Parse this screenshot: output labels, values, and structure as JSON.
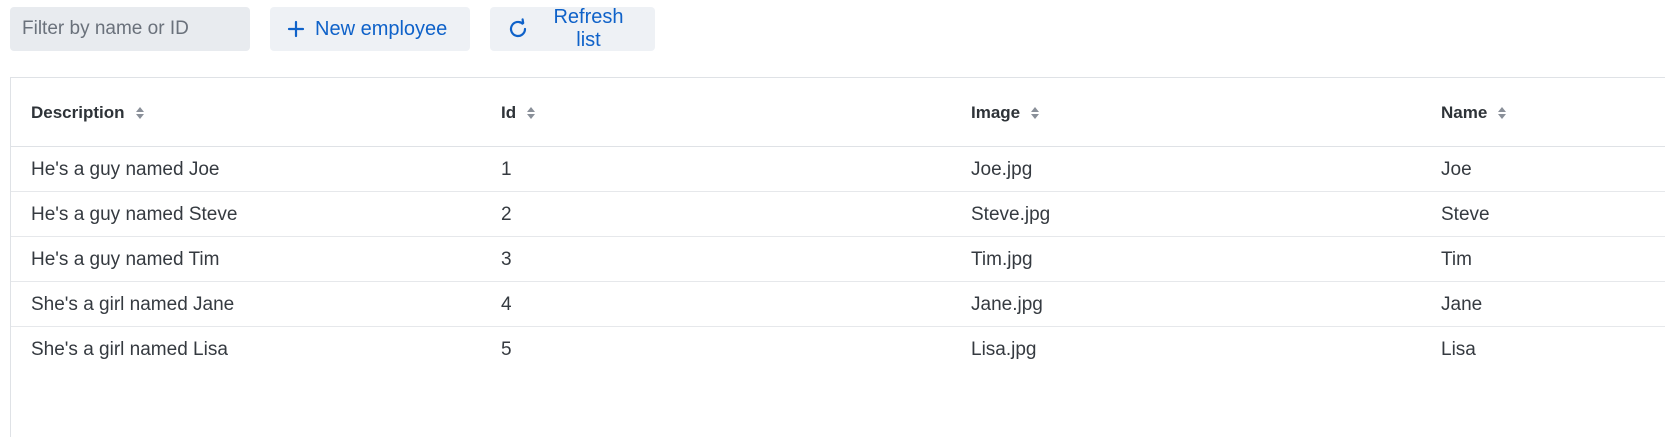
{
  "toolbar": {
    "filter_placeholder": "Filter by name or ID",
    "new_button_label": "New employee",
    "refresh_button_label": "Refresh list",
    "accent_color": "#0f62c9"
  },
  "table": {
    "columns": [
      "Description",
      "Id",
      "Image",
      "Name"
    ],
    "rows": [
      [
        "He's a guy named Joe",
        "1",
        "Joe.jpg",
        "Joe"
      ],
      [
        "He's a guy named Steve",
        "2",
        "Steve.jpg",
        "Steve"
      ],
      [
        "He's a guy named Tim",
        "3",
        "Tim.jpg",
        "Tim"
      ],
      [
        "She's a girl named Jane",
        "4",
        "Jane.jpg",
        "Jane"
      ],
      [
        "She's a girl named Lisa",
        "5",
        "Lisa.jpg",
        "Lisa"
      ]
    ]
  }
}
